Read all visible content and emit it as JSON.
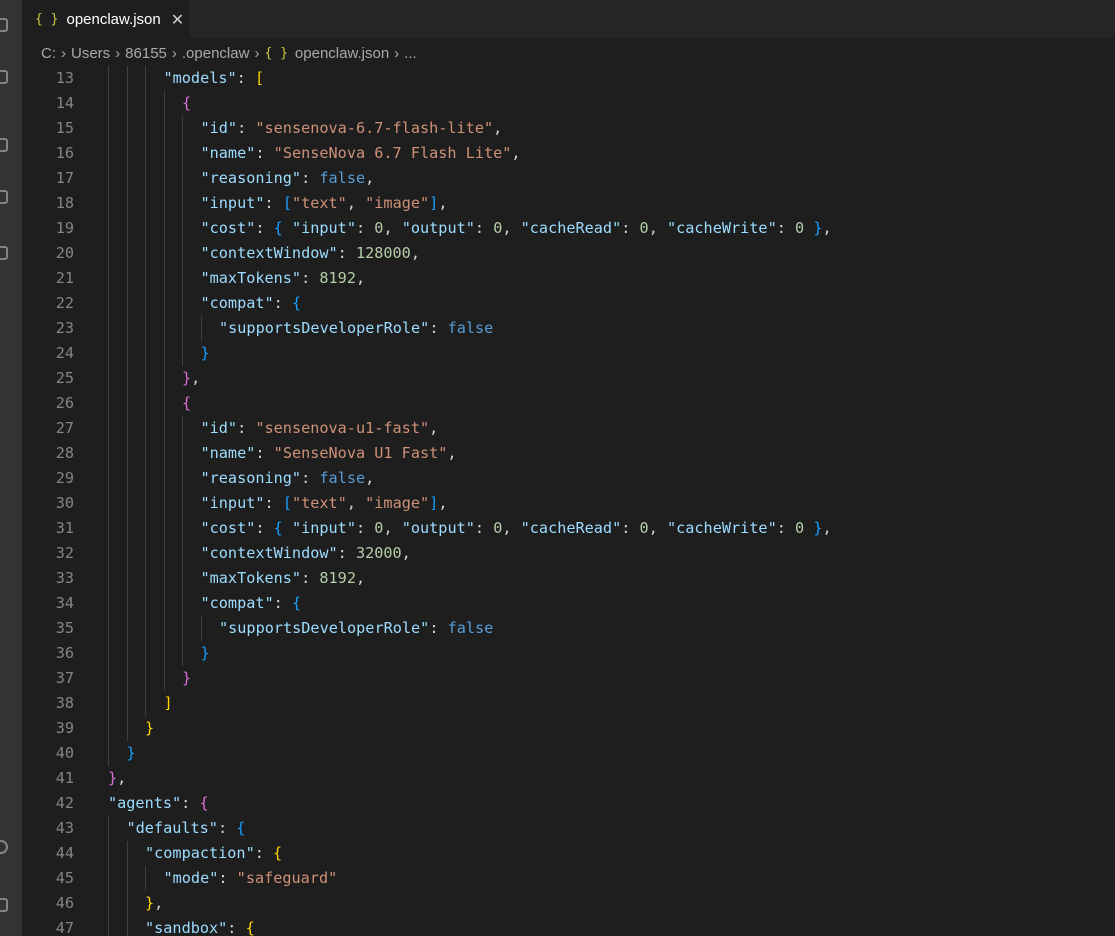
{
  "tab": {
    "icon": "{ }",
    "label": "openclaw.json",
    "close": "✕"
  },
  "breadcrumb": [
    "C:",
    "Users",
    "86155",
    ".openclaw",
    "openclaw.json",
    "..."
  ],
  "breadcrumb_file_icon": "{ }",
  "lines": [
    {
      "n": "13",
      "i": 3,
      "t": [
        [
          "k",
          "\"models\""
        ],
        [
          "p",
          ": "
        ],
        [
          "y",
          "["
        ]
      ]
    },
    {
      "n": "14",
      "i": 4,
      "t": [
        [
          "m",
          "{"
        ]
      ]
    },
    {
      "n": "15",
      "i": 5,
      "t": [
        [
          "k",
          "\"id\""
        ],
        [
          "p",
          ": "
        ],
        [
          "s",
          "\"sensenova-6.7-flash-lite\""
        ],
        [
          "p",
          ","
        ]
      ]
    },
    {
      "n": "16",
      "i": 5,
      "t": [
        [
          "k",
          "\"name\""
        ],
        [
          "p",
          ": "
        ],
        [
          "s",
          "\"SenseNova 6.7 Flash Lite\""
        ],
        [
          "p",
          ","
        ]
      ]
    },
    {
      "n": "17",
      "i": 5,
      "t": [
        [
          "k",
          "\"reasoning\""
        ],
        [
          "p",
          ": "
        ],
        [
          "b",
          "false"
        ],
        [
          "p",
          ","
        ]
      ]
    },
    {
      "n": "18",
      "i": 5,
      "t": [
        [
          "k",
          "\"input\""
        ],
        [
          "p",
          ": "
        ],
        [
          "bl",
          "["
        ],
        [
          "s",
          "\"text\""
        ],
        [
          "p",
          ", "
        ],
        [
          "s",
          "\"image\""
        ],
        [
          "bl",
          "]"
        ],
        [
          "p",
          ","
        ]
      ]
    },
    {
      "n": "19",
      "i": 5,
      "t": [
        [
          "k",
          "\"cost\""
        ],
        [
          "p",
          ": "
        ],
        [
          "bl",
          "{ "
        ],
        [
          "k",
          "\"input\""
        ],
        [
          "p",
          ": "
        ],
        [
          "n",
          "0"
        ],
        [
          "p",
          ", "
        ],
        [
          "k",
          "\"output\""
        ],
        [
          "p",
          ": "
        ],
        [
          "n",
          "0"
        ],
        [
          "p",
          ", "
        ],
        [
          "k",
          "\"cacheRead\""
        ],
        [
          "p",
          ": "
        ],
        [
          "n",
          "0"
        ],
        [
          "p",
          ", "
        ],
        [
          "k",
          "\"cacheWrite\""
        ],
        [
          "p",
          ": "
        ],
        [
          "n",
          "0"
        ],
        [
          "bl",
          " }"
        ],
        [
          "p",
          ","
        ]
      ]
    },
    {
      "n": "20",
      "i": 5,
      "t": [
        [
          "k",
          "\"contextWindow\""
        ],
        [
          "p",
          ": "
        ],
        [
          "n",
          "128000"
        ],
        [
          "p",
          ","
        ]
      ]
    },
    {
      "n": "21",
      "i": 5,
      "t": [
        [
          "k",
          "\"maxTokens\""
        ],
        [
          "p",
          ": "
        ],
        [
          "n",
          "8192"
        ],
        [
          "p",
          ","
        ]
      ]
    },
    {
      "n": "22",
      "i": 5,
      "t": [
        [
          "k",
          "\"compat\""
        ],
        [
          "p",
          ": "
        ],
        [
          "bl",
          "{"
        ]
      ]
    },
    {
      "n": "23",
      "i": 6,
      "t": [
        [
          "k",
          "\"supportsDeveloperRole\""
        ],
        [
          "p",
          ": "
        ],
        [
          "b",
          "false"
        ]
      ]
    },
    {
      "n": "24",
      "i": 5,
      "t": [
        [
          "bl",
          "}"
        ]
      ]
    },
    {
      "n": "25",
      "i": 4,
      "t": [
        [
          "m",
          "}"
        ],
        [
          "p",
          ","
        ]
      ]
    },
    {
      "n": "26",
      "i": 4,
      "t": [
        [
          "m",
          "{"
        ]
      ]
    },
    {
      "n": "27",
      "i": 5,
      "t": [
        [
          "k",
          "\"id\""
        ],
        [
          "p",
          ": "
        ],
        [
          "s",
          "\"sensenova-u1-fast\""
        ],
        [
          "p",
          ","
        ]
      ]
    },
    {
      "n": "28",
      "i": 5,
      "t": [
        [
          "k",
          "\"name\""
        ],
        [
          "p",
          ": "
        ],
        [
          "s",
          "\"SenseNova U1 Fast\""
        ],
        [
          "p",
          ","
        ]
      ]
    },
    {
      "n": "29",
      "i": 5,
      "t": [
        [
          "k",
          "\"reasoning\""
        ],
        [
          "p",
          ": "
        ],
        [
          "b",
          "false"
        ],
        [
          "p",
          ","
        ]
      ]
    },
    {
      "n": "30",
      "i": 5,
      "t": [
        [
          "k",
          "\"input\""
        ],
        [
          "p",
          ": "
        ],
        [
          "bl",
          "["
        ],
        [
          "s",
          "\"text\""
        ],
        [
          "p",
          ", "
        ],
        [
          "s",
          "\"image\""
        ],
        [
          "bl",
          "]"
        ],
        [
          "p",
          ","
        ]
      ]
    },
    {
      "n": "31",
      "i": 5,
      "t": [
        [
          "k",
          "\"cost\""
        ],
        [
          "p",
          ": "
        ],
        [
          "bl",
          "{ "
        ],
        [
          "k",
          "\"input\""
        ],
        [
          "p",
          ": "
        ],
        [
          "n",
          "0"
        ],
        [
          "p",
          ", "
        ],
        [
          "k",
          "\"output\""
        ],
        [
          "p",
          ": "
        ],
        [
          "n",
          "0"
        ],
        [
          "p",
          ", "
        ],
        [
          "k",
          "\"cacheRead\""
        ],
        [
          "p",
          ": "
        ],
        [
          "n",
          "0"
        ],
        [
          "p",
          ", "
        ],
        [
          "k",
          "\"cacheWrite\""
        ],
        [
          "p",
          ": "
        ],
        [
          "n",
          "0"
        ],
        [
          "bl",
          " }"
        ],
        [
          "p",
          ","
        ]
      ]
    },
    {
      "n": "32",
      "i": 5,
      "t": [
        [
          "k",
          "\"contextWindow\""
        ],
        [
          "p",
          ": "
        ],
        [
          "n",
          "32000"
        ],
        [
          "p",
          ","
        ]
      ]
    },
    {
      "n": "33",
      "i": 5,
      "t": [
        [
          "k",
          "\"maxTokens\""
        ],
        [
          "p",
          ": "
        ],
        [
          "n",
          "8192"
        ],
        [
          "p",
          ","
        ]
      ]
    },
    {
      "n": "34",
      "i": 5,
      "t": [
        [
          "k",
          "\"compat\""
        ],
        [
          "p",
          ": "
        ],
        [
          "bl",
          "{"
        ]
      ]
    },
    {
      "n": "35",
      "i": 6,
      "t": [
        [
          "k",
          "\"supportsDeveloperRole\""
        ],
        [
          "p",
          ": "
        ],
        [
          "b",
          "false"
        ]
      ]
    },
    {
      "n": "36",
      "i": 5,
      "t": [
        [
          "bl",
          "}"
        ]
      ]
    },
    {
      "n": "37",
      "i": 4,
      "t": [
        [
          "m",
          "}"
        ]
      ]
    },
    {
      "n": "38",
      "i": 3,
      "t": [
        [
          "y",
          "]"
        ]
      ]
    },
    {
      "n": "39",
      "i": 2,
      "t": [
        [
          "y",
          "}"
        ]
      ]
    },
    {
      "n": "40",
      "i": 1,
      "t": [
        [
          "bl",
          "}"
        ]
      ]
    },
    {
      "n": "41",
      "i": 0,
      "t": [
        [
          "m",
          "}"
        ],
        [
          "p",
          ","
        ]
      ]
    },
    {
      "n": "42",
      "i": 0,
      "t": [
        [
          "k",
          "\"agents\""
        ],
        [
          "p",
          ": "
        ],
        [
          "m",
          "{"
        ]
      ]
    },
    {
      "n": "43",
      "i": 1,
      "t": [
        [
          "k",
          "\"defaults\""
        ],
        [
          "p",
          ": "
        ],
        [
          "bl",
          "{"
        ]
      ]
    },
    {
      "n": "44",
      "i": 2,
      "t": [
        [
          "k",
          "\"compaction\""
        ],
        [
          "p",
          ": "
        ],
        [
          "y",
          "{"
        ]
      ]
    },
    {
      "n": "45",
      "i": 3,
      "t": [
        [
          "k",
          "\"mode\""
        ],
        [
          "p",
          ": "
        ],
        [
          "s",
          "\"safeguard\""
        ]
      ]
    },
    {
      "n": "46",
      "i": 2,
      "t": [
        [
          "y",
          "}"
        ],
        [
          "p",
          ","
        ]
      ]
    },
    {
      "n": "47",
      "i": 2,
      "t": [
        [
          "k",
          "\"sandbox\""
        ],
        [
          "p",
          ": "
        ],
        [
          "y",
          "{"
        ]
      ]
    }
  ]
}
